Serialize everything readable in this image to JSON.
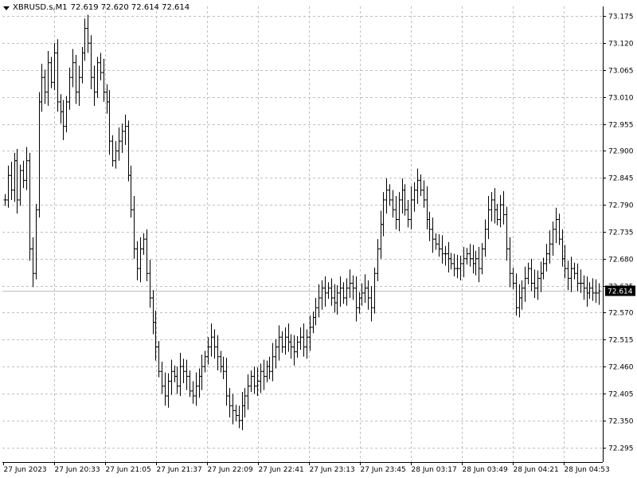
{
  "header": {
    "symbol": "XBRUSD.s,M1",
    "ohlc": "72.619 72.620 72.614 72.614",
    "dropdown_icon": "triangle-down-icon"
  },
  "chart_data": {
    "type": "bar",
    "style": "ohlc",
    "grid": true,
    "ylim": [
      72.265,
      73.195
    ],
    "yticks": [
      "73.175",
      "73.120",
      "73.065",
      "73.010",
      "72.955",
      "72.900",
      "72.845",
      "72.790",
      "72.735",
      "72.680",
      "72.625",
      "72.570",
      "72.515",
      "72.460",
      "72.405",
      "72.350",
      "72.295"
    ],
    "xtick_labels": [
      "27 Jun 2023",
      "27 Jun 20:33",
      "27 Jun 21:05",
      "27 Jun 21:37",
      "27 Jun 22:09",
      "27 Jun 22:41",
      "27 Jun 23:13",
      "27 Jun 23:45",
      "28 Jun 03:17",
      "28 Jun 03:49",
      "28 Jun 04:21",
      "28 Jun 04:53"
    ],
    "current_price": "72.614",
    "current_price_value": 72.614,
    "colors": {
      "bars": "#000000",
      "grid": "#c0c0c0",
      "price_line": "#c0c0c0",
      "price_label_bg": "#000000",
      "price_label_text": "#ffffff"
    },
    "closes": [
      72.8,
      72.85,
      72.82,
      72.88,
      72.8,
      72.86,
      72.84,
      72.88,
      72.7,
      72.65,
      72.78,
      73.0,
      73.05,
      73.02,
      73.08,
      73.04,
      73.1,
      73.0,
      72.98,
      72.95,
      73.0,
      73.05,
      73.08,
      73.02,
      73.05,
      73.1,
      73.15,
      73.12,
      73.05,
      73.02,
      73.08,
      73.06,
      73.02,
      73.0,
      72.92,
      72.88,
      72.9,
      72.92,
      72.94,
      72.95,
      72.85,
      72.78,
      72.7,
      72.66,
      72.7,
      72.72,
      72.65,
      72.6,
      72.55,
      72.5,
      72.45,
      72.42,
      72.4,
      72.43,
      72.45,
      72.44,
      72.42,
      72.46,
      72.45,
      72.44,
      72.41,
      72.4,
      72.42,
      72.44,
      72.46,
      72.48,
      72.5,
      72.52,
      72.5,
      72.48,
      72.46,
      72.45,
      72.4,
      72.38,
      72.37,
      72.36,
      72.35,
      72.38,
      72.4,
      72.42,
      72.44,
      72.42,
      72.43,
      72.45,
      72.44,
      72.46,
      72.45,
      72.48,
      72.5,
      72.52,
      72.5,
      72.52,
      72.51,
      72.5,
      72.49,
      72.51,
      72.52,
      72.5,
      72.52,
      72.54,
      72.56,
      72.58,
      72.6,
      72.62,
      72.61,
      72.62,
      72.6,
      72.59,
      72.61,
      72.62,
      72.6,
      72.62,
      72.63,
      72.62,
      72.58,
      72.6,
      72.61,
      72.62,
      72.6,
      72.58,
      72.65,
      72.7,
      72.75,
      72.8,
      72.82,
      72.8,
      72.78,
      72.76,
      72.8,
      72.82,
      72.78,
      72.76,
      72.8,
      72.82,
      72.84,
      72.82,
      72.8,
      72.76,
      72.74,
      72.72,
      72.71,
      72.7,
      72.69,
      72.69,
      72.68,
      72.67,
      72.66,
      72.66,
      72.67,
      72.68,
      72.69,
      72.68,
      72.67,
      72.68,
      72.66,
      72.7,
      72.74,
      72.78,
      72.8,
      72.78,
      72.76,
      72.79,
      72.77,
      72.7,
      72.65,
      72.63,
      72.58,
      72.6,
      72.62,
      72.64,
      72.66,
      72.63,
      72.62,
      72.64,
      72.65,
      72.67,
      72.69,
      72.71,
      72.74,
      72.76,
      72.72,
      72.68,
      72.66,
      72.64,
      72.66,
      72.65,
      72.63,
      72.63,
      72.62,
      72.61,
      72.62,
      72.61,
      72.61,
      72.614
    ]
  }
}
